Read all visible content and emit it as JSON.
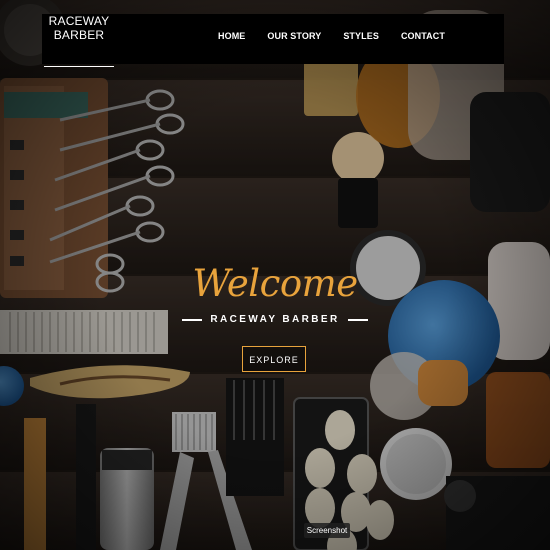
{
  "brand": {
    "line1": "RACEWAY",
    "line2": "BARBER"
  },
  "nav": {
    "items": [
      {
        "label": "HOME"
      },
      {
        "label": "OUR STORY"
      },
      {
        "label": "STYLES"
      },
      {
        "label": "CONTACT"
      }
    ]
  },
  "hero": {
    "welcome": "Welcome",
    "subtitle": "RACEWAY BARBER",
    "explore_label": "EXPLORE",
    "image": "barber-tools-flatlay-image"
  },
  "chip": {
    "label": "Screenshot"
  },
  "colors": {
    "accent": "#e8a33c",
    "navbar": "#000000",
    "text": "#ffffff"
  }
}
